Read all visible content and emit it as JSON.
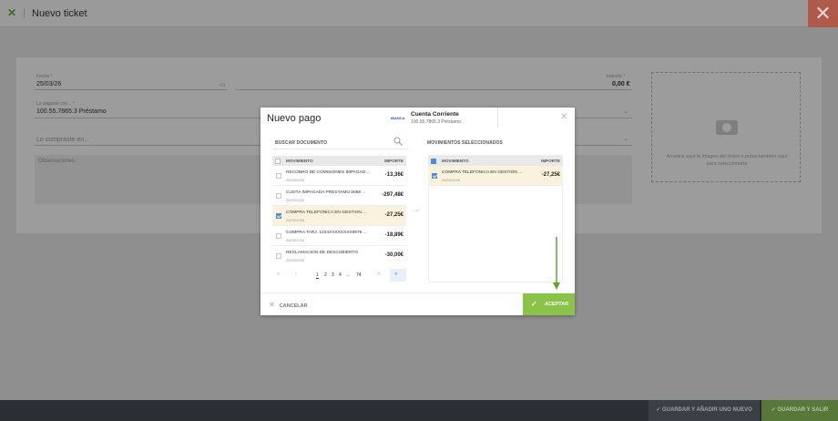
{
  "app": {
    "title": "Nuevo ticket",
    "logo_icon": "x-logo-icon",
    "close_icon": "close-icon"
  },
  "form": {
    "fecha_label": "Fecha *",
    "fecha_value": "25/03/26",
    "importe_label": "Importe *",
    "importe_value": "0,00 €",
    "pagado_label": "Lo pagaste con... *",
    "pagado_value": "100.55.7865.3 Préstamo",
    "comprado_label": "Lo compraste en...",
    "observaciones_label": "Observaciones",
    "drop_text": "Arrastra aquí la imagen del ticket o pulsa también aquí para seleccionarla"
  },
  "footer": {
    "save_new": "GUARDAR Y AÑADIR UNO NUEVO",
    "save_exit": "GUARDAR Y SALIR"
  },
  "modal": {
    "title": "Nuevo pago",
    "brand": "IBANCA",
    "account_name": "Cuenta Corriente",
    "account_number": "100.55.7865.3 Préstamo",
    "search_label": "BUSCAR DOCUMENTO",
    "selected_label": "MOVIMIENTOS SELECCIONADOS",
    "col_mov": "MOVIMIENTO",
    "col_imp": "IMPORTE",
    "rows": [
      {
        "desc": "RECOBRO DE COMISIONES IMPAGAD...",
        "date": "25/03/2026",
        "amount": "-13,36€",
        "checked": false
      },
      {
        "desc": "CUOTA IMPAGADA PRESTAMO 0069 ...",
        "date": "25/03/2026",
        "amount": "-297,48€",
        "checked": false
      },
      {
        "desc": "COMPRA TELEFONICA EN GESTION ...",
        "date": "25/03/2026",
        "amount": "-27,25€",
        "checked": true
      },
      {
        "desc": "COMPRA TARJ. 1234XXXXXXXX9876 ...",
        "date": "25/03/2026",
        "amount": "-18,89€",
        "checked": false
      },
      {
        "desc": "RECLAMACION DE DESCUBIERTO",
        "date": "25/03/2026",
        "amount": "-30,00€",
        "checked": false
      }
    ],
    "selected_rows": [
      {
        "desc": "COMPRA TELEFONICA EN GESTION ...",
        "date": "25/03/2026",
        "amount": "-27,25€",
        "checked": true
      }
    ],
    "pages": [
      "1",
      "2",
      "3",
      "4",
      "...",
      "74"
    ],
    "current_page": "1",
    "cancel": "CANCELAR",
    "accept": "ACEPTAR"
  },
  "colors": {
    "accept_green": "#8bc34a",
    "selected_row": "#fbf2dd",
    "check_blue": "#4a8fd4",
    "header_close": "#b05a4a"
  }
}
